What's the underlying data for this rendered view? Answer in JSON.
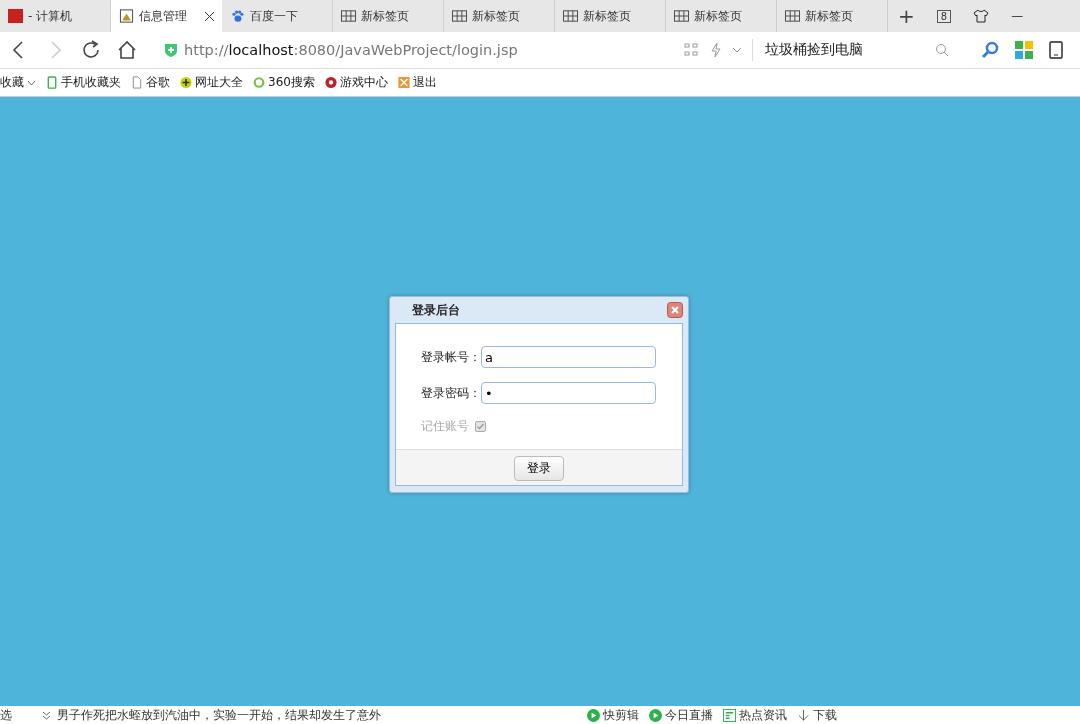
{
  "browser": {
    "tabs": [
      {
        "label": "- 计算机",
        "kind": "app",
        "selected": false
      },
      {
        "label": "信息管理",
        "kind": "page",
        "selected": true
      },
      {
        "label": "百度一下",
        "kind": "paw",
        "selected": false
      },
      {
        "label": "新标签页",
        "kind": "grid",
        "selected": false
      },
      {
        "label": "新标签页",
        "kind": "grid",
        "selected": false
      },
      {
        "label": "新标签页",
        "kind": "grid",
        "selected": false
      },
      {
        "label": "新标签页",
        "kind": "grid",
        "selected": false
      },
      {
        "label": "新标签页",
        "kind": "grid",
        "selected": false
      }
    ],
    "new_tab": "+",
    "tab_count": "8",
    "window_min": "—",
    "url": {
      "prefix": "http://",
      "host": "localhost",
      "rest": ":8080/JavaWebProject/login.jsp"
    },
    "search": {
      "value": "垃圾桶捡到电脑"
    },
    "bookmarks": [
      {
        "label": "收藏",
        "kind": "menu"
      },
      {
        "label": "手机收藏夹",
        "kind": "phone"
      },
      {
        "label": "谷歌",
        "kind": "doc"
      },
      {
        "label": "网址大全",
        "kind": "plus"
      },
      {
        "label": "360搜索",
        "kind": "ring"
      },
      {
        "label": "游戏中心",
        "kind": "game"
      },
      {
        "label": "退出",
        "kind": "exit"
      }
    ]
  },
  "dialog": {
    "title": "登录后台",
    "fields": [
      {
        "label": "登录帐号：",
        "value": "a"
      },
      {
        "label": "登录密码：",
        "value": "•"
      }
    ],
    "remember": {
      "label": "记住账号",
      "checked": true,
      "disabled": true
    },
    "submit": "登录"
  },
  "status_bar": {
    "left": "选",
    "news": "男子作死把水蛭放到汽油中，实验一开始，结果却发生了意外",
    "items": [
      {
        "label": "快剪辑",
        "kind": "play"
      },
      {
        "label": "今日直播",
        "kind": "play"
      },
      {
        "label": "热点资讯",
        "kind": "news"
      },
      {
        "label": "下载",
        "kind": "download"
      }
    ]
  }
}
